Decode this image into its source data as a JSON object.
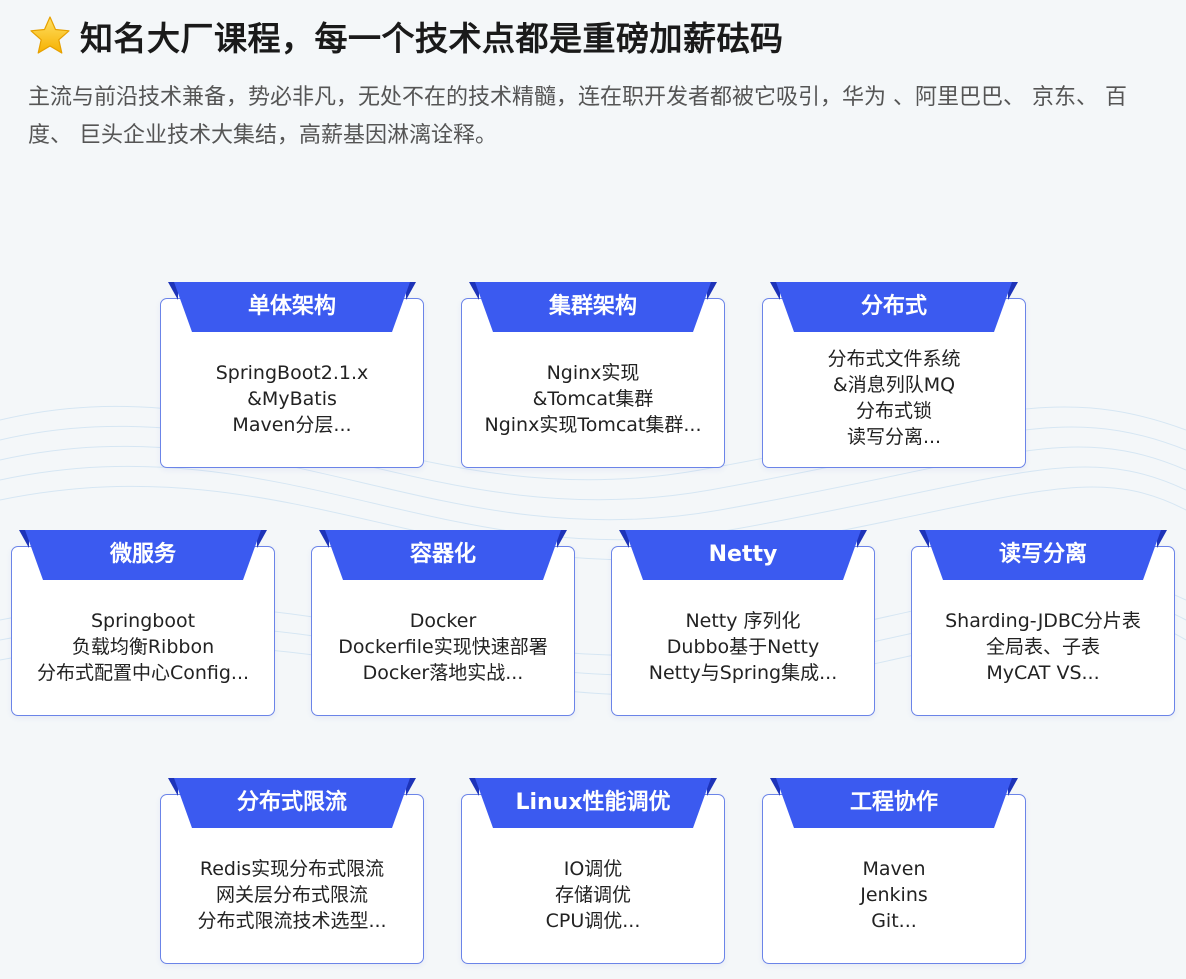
{
  "header": {
    "title": "知名大厂课程，每一个技术点都是重磅加薪砝码",
    "subtitle": "主流与前沿技术兼备，势必非凡，无处不在的技术精髓，连在职开发者都被它吸引，华为 、阿里巴巴、 京东、 百度、 巨头企业技术大集结，高薪基因淋漓诠释。",
    "icon": "star-icon"
  },
  "colors": {
    "accent": "#3b5af0",
    "accent_dark": "#1d33b8",
    "border": "#6b84e8"
  },
  "cards": [
    {
      "title": "单体架构",
      "lines": [
        "SpringBoot2.1.x",
        "&MyBatis",
        "Maven分层..."
      ]
    },
    {
      "title": "集群架构",
      "lines": [
        "Nginx实现",
        "&Tomcat集群",
        "Nginx实现Tomcat集群..."
      ]
    },
    {
      "title": "分布式",
      "lines": [
        "分布式文件系统",
        "&消息列队MQ",
        "分布式锁",
        "读写分离..."
      ]
    },
    {
      "title": "微服务",
      "lines": [
        "Springboot",
        "负载均衡Ribbon",
        "分布式配置中心Config..."
      ]
    },
    {
      "title": "容器化",
      "lines": [
        "Docker",
        "Dockerfile实现快速部署",
        "Docker落地实战..."
      ]
    },
    {
      "title": "Netty",
      "lines": [
        "Netty 序列化",
        "Dubbo基于Netty",
        "Netty与Spring集成..."
      ]
    },
    {
      "title": "读写分离",
      "lines": [
        "Sharding-JDBC分片表",
        "全局表、子表",
        "MyCAT VS..."
      ]
    },
    {
      "title": "分布式限流",
      "lines": [
        "Redis实现分布式限流",
        "网关层分布式限流",
        "分布式限流技术选型..."
      ]
    },
    {
      "title": "Linux性能调优",
      "lines": [
        "IO调优",
        "存储调优",
        "CPU调优..."
      ]
    },
    {
      "title": "工程协作",
      "lines": [
        "Maven",
        "Jenkins",
        "Git..."
      ]
    }
  ]
}
